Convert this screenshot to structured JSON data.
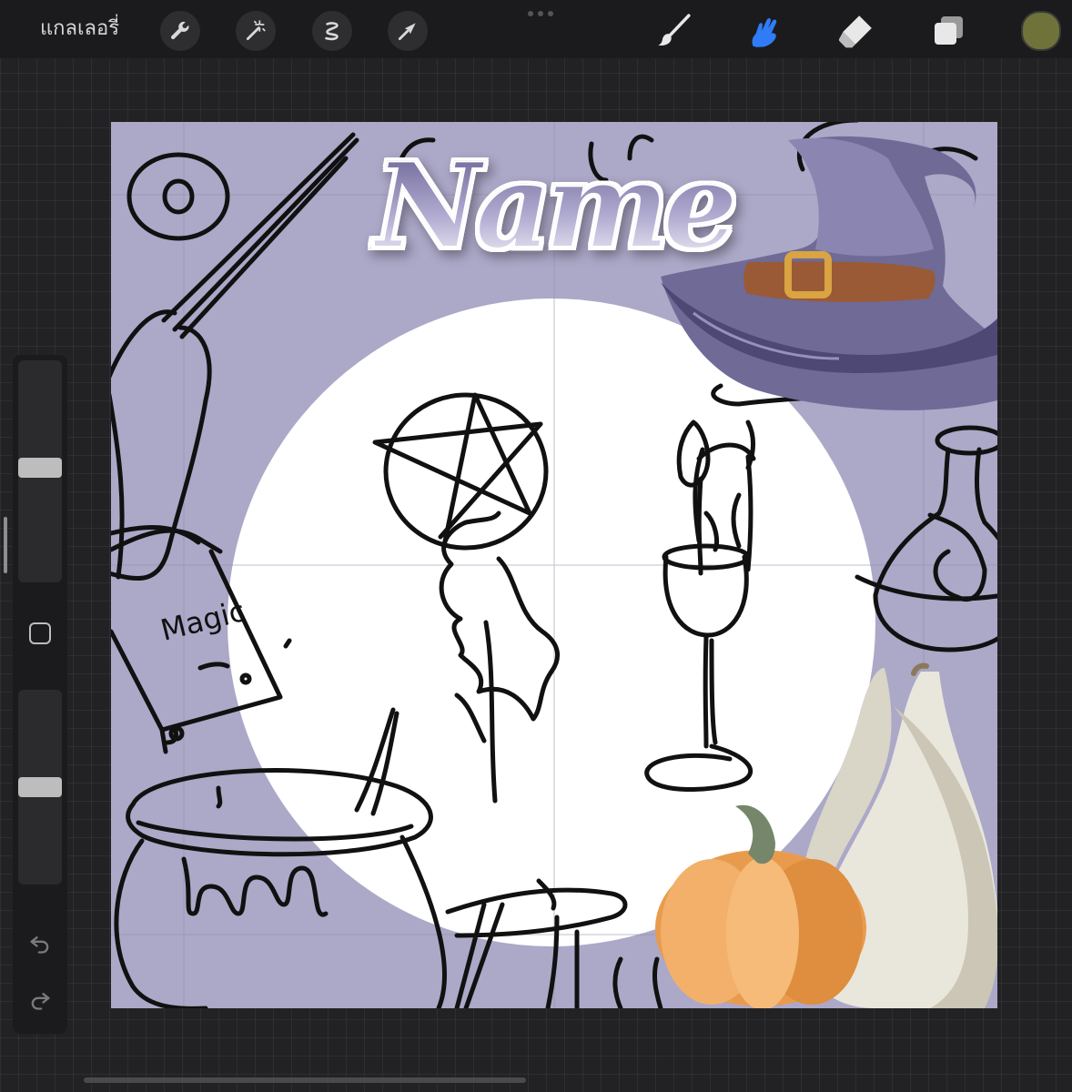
{
  "toolbar": {
    "gallery_label": "แกลเลอรี่",
    "left_tools": [
      "wrench-icon",
      "magic-wand-icon",
      "selection-icon",
      "transform-arrow-icon"
    ],
    "right_tools": [
      "brush-icon",
      "smudge-icon",
      "eraser-icon",
      "layers-icon"
    ],
    "active_tool": "smudge-icon",
    "active_color": "#6f7339",
    "accent_color": "#2f7cf6"
  },
  "sidebar": {
    "brush_size": 0.48,
    "opacity": 0.5
  },
  "canvas": {
    "background_color": "#aca8c8",
    "circle_color": "#ffffff",
    "sticker_text": "Name",
    "book_text": "Magic"
  }
}
